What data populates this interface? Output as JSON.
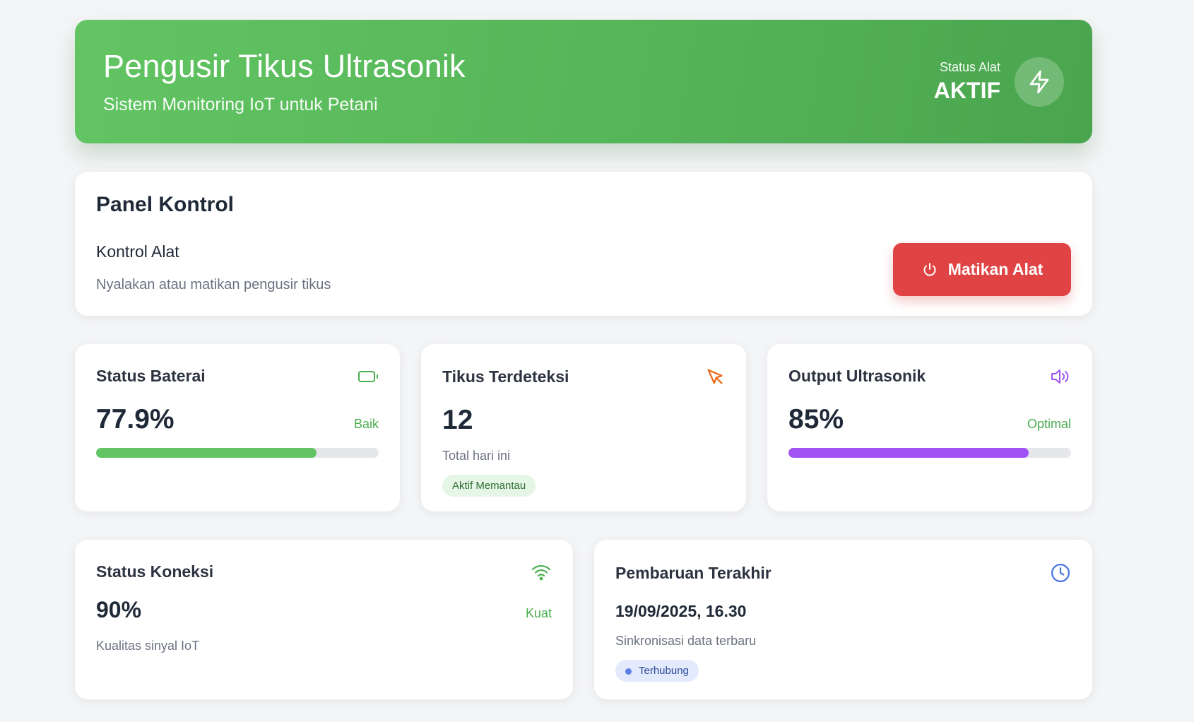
{
  "header": {
    "title": "Pengusir Tikus Ultrasonik",
    "subtitle": "Sistem Monitoring IoT untuk Petani",
    "status_label": "Status Alat",
    "status_value": "AKTIF",
    "icon": "bolt-icon"
  },
  "panel": {
    "title": "Panel Kontrol",
    "control_title": "Kontrol Alat",
    "control_desc": "Nyalakan atau matikan pengusir tikus",
    "button_label": "Matikan Alat",
    "button_icon": "power-icon",
    "button_color": "#e04343"
  },
  "battery": {
    "title": "Status Baterai",
    "icon": "battery-icon",
    "value": "77.9%",
    "tag": "Baik",
    "level": 0.779,
    "color": "#62c462"
  },
  "rats": {
    "title": "Tikus Terdeteksi",
    "icon": "cursor-icon",
    "value": "12",
    "sub": "Total hari ini",
    "badge": "Aktif Memantau",
    "color": "#ea6b1a"
  },
  "ultrasonic": {
    "title": "Output Ultrasonik",
    "icon": "speaker-icon",
    "value": "85%",
    "tag": "Optimal",
    "level": 0.85,
    "color": "#a052f2"
  },
  "connection": {
    "title": "Status Koneksi",
    "icon": "wifi-icon",
    "value": "90%",
    "tag": "Kuat",
    "sub": "Kualitas sinyal IoT",
    "color": "#4caf50"
  },
  "update": {
    "title": "Pembaruan Terakhir",
    "icon": "clock-icon",
    "datetime": "19/09/2025, 16.30",
    "sub": "Sinkronisasi data terbaru",
    "badge": "Terhubung",
    "color": "#4a74e0"
  }
}
